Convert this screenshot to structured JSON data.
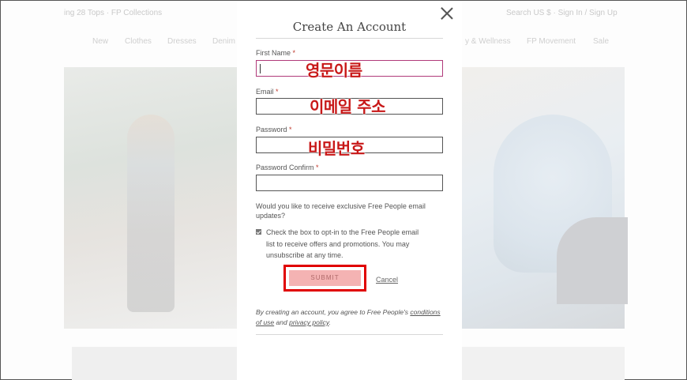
{
  "background": {
    "top_left_text": "ing 28 Tops  ·  FP Collections",
    "top_right_text": "Search  US $  ·  Sign In / Sign Up",
    "nav": [
      "New",
      "Clothes",
      "Dresses",
      "Denim",
      "y & Wellness",
      "FP Movement",
      "Sale"
    ]
  },
  "modal": {
    "title": "Create An Account",
    "close_icon": "close-icon",
    "fields": [
      {
        "label": "First Name",
        "required_mark": "*",
        "value": "",
        "annotation": "영문이름"
      },
      {
        "label": "Email",
        "required_mark": "*",
        "value": "",
        "annotation": "이메일 주소"
      },
      {
        "label": "Password",
        "required_mark": "*",
        "value": "",
        "annotation": "비밀번호"
      },
      {
        "label": "Password Confirm",
        "required_mark": "*",
        "value": ""
      }
    ],
    "optin_question": "Would you like to receive exclusive Free People email updates?",
    "optin_checked": true,
    "optin_text": "Check the box to opt-in to the Free People email list to receive offers and promotions. You may unsubscribe at any time.",
    "submit_label": "SUBMIT",
    "cancel_label": "Cancel",
    "terms_prefix": "By creating an account, you agree to Free People's",
    "terms_link": "conditions of use",
    "terms_and": "and",
    "privacy_link": "privacy policy",
    "terms_end": "."
  },
  "colors": {
    "annotation": "#c81818",
    "submit_bg": "#f4b3b3",
    "highlight_border": "#e00000",
    "focus_border": "#b03a7a"
  }
}
